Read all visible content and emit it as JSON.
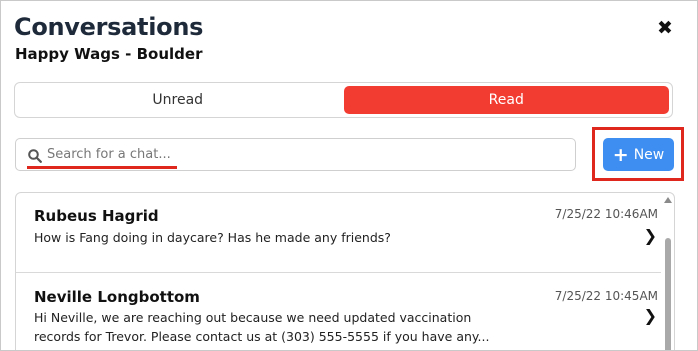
{
  "header": {
    "title": "Conversations",
    "subtitle": "Happy Wags - Boulder",
    "close_glyph": "✖",
    "close_icon": "close-icon"
  },
  "tabs": [
    {
      "label": "Unread",
      "active": false
    },
    {
      "label": "Read",
      "active": true
    }
  ],
  "search": {
    "placeholder": "Search for a chat...",
    "value": "",
    "icon": "search-icon"
  },
  "new_button": {
    "label": "New",
    "icon_glyph": "+",
    "icon": "plus-icon"
  },
  "conversations": [
    {
      "name": "Rubeus Hagrid",
      "time": "7/25/22 10:46AM",
      "message_lines": [
        "How is Fang doing in daycare? Has he made any friends?"
      ],
      "chevron": "❯"
    },
    {
      "name": "Neville Longbottom",
      "time": "7/25/22 10:45AM",
      "message_lines": [
        "Hi Neville, we are reaching out because we need updated vaccination",
        "records for Trevor. Please contact us at (303) 555-5555 if you have any..."
      ],
      "chevron": "❯"
    }
  ],
  "colors": {
    "accent_red": "#f23c32",
    "button_blue": "#3d8ef0",
    "annotation_red": "#e0271d",
    "title_color": "#1e2a3a"
  }
}
